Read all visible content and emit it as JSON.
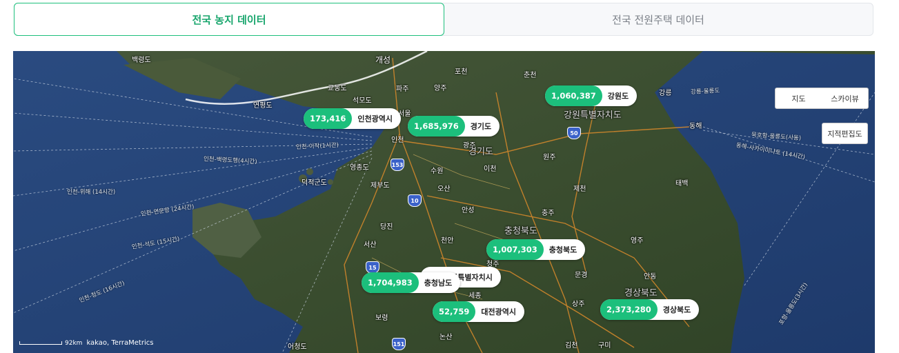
{
  "tabs": [
    {
      "label": "전국 농지 데이터",
      "active": true
    },
    {
      "label": "전국 전원주택 데이터",
      "active": false
    }
  ],
  "map_controls": {
    "map_label": "지도",
    "skyview_label": "스카이뷰",
    "cadastral_label": "지적편집도"
  },
  "scale": {
    "text": "92km",
    "attribution": "kakao, TerraMetrics"
  },
  "stats": [
    {
      "value": "1,060,387",
      "region": "강원도"
    },
    {
      "value": "173,416",
      "region": "인천광역시"
    },
    {
      "value": "1,685,976",
      "region": "경기도"
    },
    {
      "value": "1,007,303",
      "region": "충청북도"
    },
    {
      "value": "1,704,983",
      "region": "충청남도"
    },
    {
      "value": "52,759",
      "region": "대전광역시"
    },
    {
      "value": "2,373,280",
      "region": "경상북도"
    }
  ],
  "sejong_label": "세종특별자치시",
  "places": {
    "gaeseong": "개성",
    "pocheon": "포천",
    "chuncheon": "춘천",
    "paju": "파주",
    "yangju": "양주",
    "seoul": "서울",
    "incheon": "인천",
    "gwangju": "광주",
    "suwon": "수원",
    "icheon": "이천",
    "wonju": "원주",
    "osan": "오산",
    "anseong": "안성",
    "chungju": "충주",
    "jecheon": "제천",
    "taebaek": "태백",
    "gangneung": "강릉",
    "donghae": "동해",
    "dangjin": "당진",
    "cheonan": "천안",
    "seosan": "서산",
    "cheongju": "청주",
    "sejong": "세종",
    "mungyeong": "문경",
    "andong": "안동",
    "sangju": "상주",
    "boryeong": "보령",
    "nonsan": "논산",
    "gimcheon": "김천",
    "gumi": "구미",
    "yeongju": "영주",
    "gyeonggi": "경기도",
    "gangwon": "강원특별자치도",
    "chungbuk": "충청북도",
    "gyeongbuk": "경상북도",
    "baengnyeong": "백령도",
    "yeonpyeong": "연평도",
    "gyodong": "교동도",
    "seokmo": "석모도",
    "yeongjong": "영종도",
    "jebu": "제부도",
    "deokjeok": "덕적군도",
    "eocheong": "어청도"
  },
  "routes": {
    "r1": "인천-이작(1시간)",
    "r2": "인천-백령도행(4시간)",
    "r3": "인천-위해 (14시간)",
    "r4": "인천-연운항 (24시간)",
    "r5": "인천-석도 (15시간)",
    "r6": "인천-청도 (16시간)",
    "r7": "묵호항-울릉도(사동)",
    "r8": "동해-사카이미나토 (14시간)",
    "r9": "강릉-울릉도",
    "r10": "포항-울릉도(3시간)"
  },
  "highways": [
    "50",
    "153",
    "10",
    "15",
    "151"
  ]
}
